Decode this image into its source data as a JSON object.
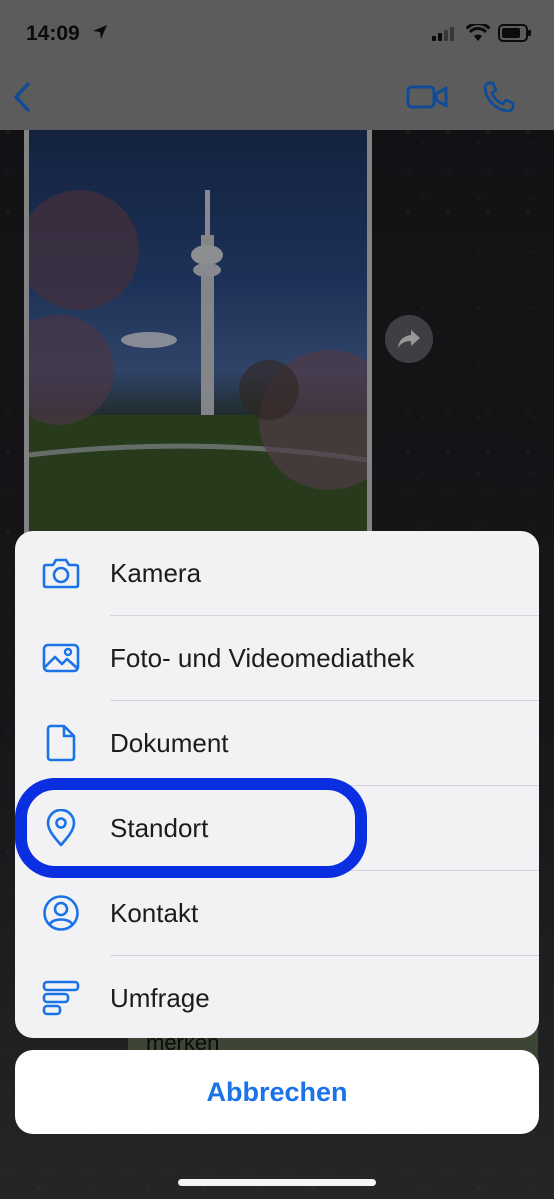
{
  "status_bar": {
    "time": "14:09"
  },
  "colors": {
    "accent": "#1a73e8",
    "highlight": "#0a2fe0",
    "sheet_bg": "#f2f2f4"
  },
  "header": {
    "back_icon": "chevron-left-icon",
    "video_icon": "video-camera-icon",
    "call_icon": "phone-icon"
  },
  "chat": {
    "partial_message": "merken"
  },
  "action_sheet": {
    "items": [
      {
        "label": "Kamera",
        "icon": "camera-icon"
      },
      {
        "label": "Foto- und Videomediathek",
        "icon": "photo-library-icon"
      },
      {
        "label": "Dokument",
        "icon": "document-icon"
      },
      {
        "label": "Standort",
        "icon": "location-pin-icon"
      },
      {
        "label": "Kontakt",
        "icon": "contact-icon"
      },
      {
        "label": "Umfrage",
        "icon": "poll-icon"
      }
    ],
    "cancel_label": "Abbrechen"
  }
}
